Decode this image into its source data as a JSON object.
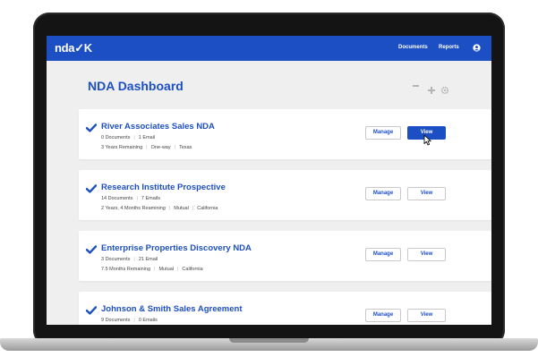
{
  "app": {
    "logo": "nda✓K",
    "nav": [
      "Documents",
      "Reports"
    ],
    "user_icon": "user-circle-icon"
  },
  "page": {
    "title": "NDA Dashboard",
    "toolbar_icons": [
      "ellipsis-icon",
      "plus-icon",
      "gear-icon"
    ]
  },
  "cards": [
    {
      "title": "River Associates Sales NDA",
      "line1": [
        "0 Documents",
        "1 Email"
      ],
      "line2": [
        "3 Years Remaining",
        "One-way",
        "Texas"
      ],
      "manage_label": "Manage",
      "view_label": "View",
      "view_active": true
    },
    {
      "title": "Research Institute Prospective",
      "line1": [
        "14 Documents",
        "7 Emails"
      ],
      "line2": [
        "2 Years, 4 Months Reamining",
        "Mutual",
        "California"
      ],
      "manage_label": "Manage",
      "view_label": "View",
      "view_active": false
    },
    {
      "title": "Enterprise Properties Discovery NDA",
      "line1": [
        "3 Documents",
        "21 Email"
      ],
      "line2": [
        "7.5 Months Remaining",
        "Mutual",
        "California"
      ],
      "manage_label": "Manage",
      "view_label": "View",
      "view_active": false
    },
    {
      "title": "Johnson & Smith Sales Agreement",
      "line1": [
        "9 Documents",
        "0 Emails"
      ],
      "line2": [],
      "manage_label": "Manage",
      "view_label": "View",
      "view_active": false
    }
  ],
  "colors": {
    "brand_blue": "#1d4fc4",
    "background": "#efefef",
    "laptop_bezel": "#141414"
  }
}
